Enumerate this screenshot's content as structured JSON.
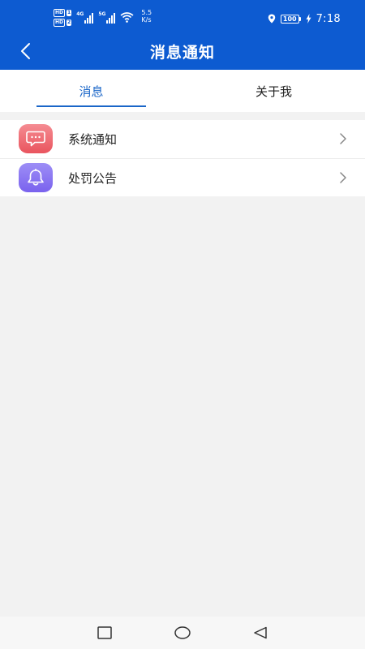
{
  "status_bar": {
    "sim1": {
      "tag": "HD",
      "num": "1"
    },
    "sim2": {
      "tag": "HD",
      "num": "2"
    },
    "network1": "4G",
    "network2": "5G",
    "speed_value": "5.5",
    "speed_unit": "K/s",
    "battery": "100",
    "time": "7:18",
    "icons": [
      "signal-bars-icon",
      "wifi-icon",
      "location-icon",
      "battery-icon",
      "charging-icon"
    ]
  },
  "header": {
    "title": "消息通知",
    "back_icon": "chevron-left-icon",
    "color": "#0d5bd1"
  },
  "tabs": [
    {
      "label": "消息",
      "active": true
    },
    {
      "label": "关于我",
      "active": false
    }
  ],
  "accent_color": "#1a66c8",
  "messages": [
    {
      "label": "系统通知",
      "icon": "chat-bubble-icon",
      "icon_color": "#ef6b74"
    },
    {
      "label": "处罚公告",
      "icon": "bell-icon",
      "icon_color": "#8a76f2"
    }
  ],
  "nav_bar": {
    "buttons": [
      "recent-apps-square-icon",
      "home-circle-icon",
      "back-triangle-icon"
    ]
  }
}
